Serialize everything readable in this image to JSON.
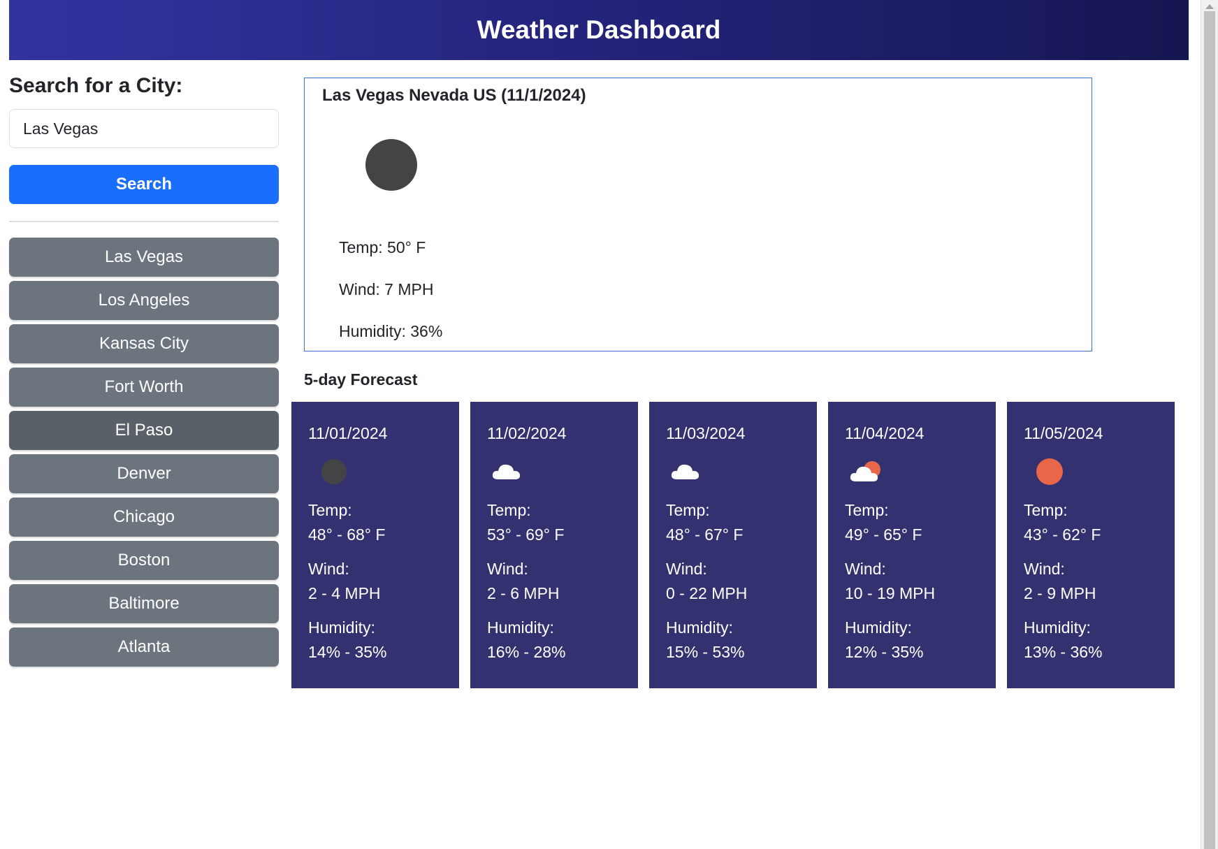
{
  "header": {
    "title": "Weather Dashboard"
  },
  "sidebar": {
    "heading": "Search for a City:",
    "search_value": "Las Vegas",
    "search_button": "Search",
    "cities": [
      "Las Vegas",
      "Los Angeles",
      "Kansas City",
      "Fort Worth",
      "El Paso",
      "Denver",
      "Chicago",
      "Boston",
      "Baltimore",
      "Atlanta"
    ],
    "active_city": "El Paso"
  },
  "current": {
    "title": "Las Vegas Nevada US (11/1/2024)",
    "icon": "moon-icon",
    "temp": "Temp: 50° F",
    "wind": "Wind: 7 MPH",
    "humidity": "Humidity: 36%"
  },
  "forecast": {
    "title": "5-day Forecast",
    "temp_label": "Temp:",
    "wind_label": "Wind:",
    "humidity_label": "Humidity:",
    "days": [
      {
        "date": "11/01/2024",
        "icon": "moon-icon",
        "temp": "48° - 68° F",
        "wind": "2 - 4 MPH",
        "humidity": "14% - 35%"
      },
      {
        "date": "11/02/2024",
        "icon": "cloud-icon",
        "temp": "53° - 69° F",
        "wind": "2 - 6 MPH",
        "humidity": "16% - 28%"
      },
      {
        "date": "11/03/2024",
        "icon": "cloud-icon",
        "temp": "48° - 67° F",
        "wind": "0 - 22 MPH",
        "humidity": "15% - 53%"
      },
      {
        "date": "11/04/2024",
        "icon": "partly-cloudy-icon",
        "temp": "49° - 65° F",
        "wind": "10 - 19 MPH",
        "humidity": "12% - 35%"
      },
      {
        "date": "11/05/2024",
        "icon": "sun-icon",
        "temp": "43° - 62° F",
        "wind": "2 - 9 MPH",
        "humidity": "13% - 36%"
      }
    ]
  },
  "colors": {
    "header_start": "#3333a0",
    "header_end": "#161652",
    "search_button": "#1a6efd",
    "city_button": "#6c747d",
    "city_button_active": "#5a6068",
    "card_background": "#343170",
    "moon": "#444446",
    "sun": "#e8664a"
  }
}
